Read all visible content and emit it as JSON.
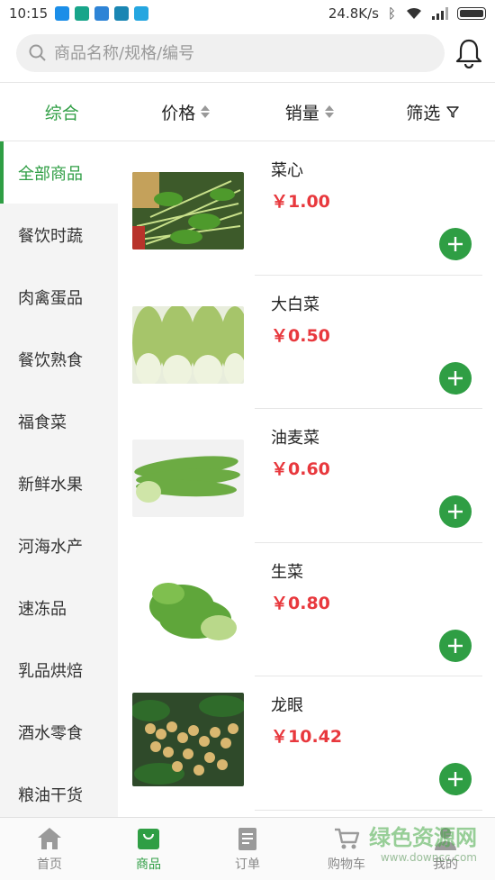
{
  "status_bar": {
    "time": "10:15",
    "speed": "24.8K/s"
  },
  "search": {
    "placeholder": "商品名称/规格/编号"
  },
  "sort_tabs": [
    {
      "label": "综合",
      "active": true
    },
    {
      "label": "价格"
    },
    {
      "label": "销量"
    },
    {
      "label": "筛选"
    }
  ],
  "categories": [
    "全部商品",
    "餐饮时蔬",
    "肉禽蛋品",
    "餐饮熟食",
    "福食菜",
    "新鲜水果",
    "河海水产",
    "速冻品",
    "乳品烘焙",
    "酒水零食",
    "粮油干货"
  ],
  "products": [
    {
      "name": "菜心",
      "price": "￥1.00",
      "image": "choy-sum-photo"
    },
    {
      "name": "大白菜",
      "price": "￥0.50",
      "image": "napa-cabbage-photo"
    },
    {
      "name": "油麦菜",
      "price": "￥0.60",
      "image": "a-choy-photo"
    },
    {
      "name": "生菜",
      "price": "￥0.80",
      "image": "lettuce-photo"
    },
    {
      "name": "龙眼",
      "price": "￥10.42",
      "image": "longan-photo"
    }
  ],
  "tabs": [
    {
      "label": "首页",
      "icon": "home-icon"
    },
    {
      "label": "商品",
      "icon": "bag-icon",
      "active": true
    },
    {
      "label": "订单",
      "icon": "order-icon"
    },
    {
      "label": "购物车",
      "icon": "cart-icon"
    },
    {
      "label": "我的",
      "icon": "user-icon"
    }
  ],
  "watermark": {
    "text": "绿色资源网",
    "sub": "www.downcc.com"
  },
  "colors": {
    "accent": "#2f9e44",
    "price": "#e8383d"
  }
}
